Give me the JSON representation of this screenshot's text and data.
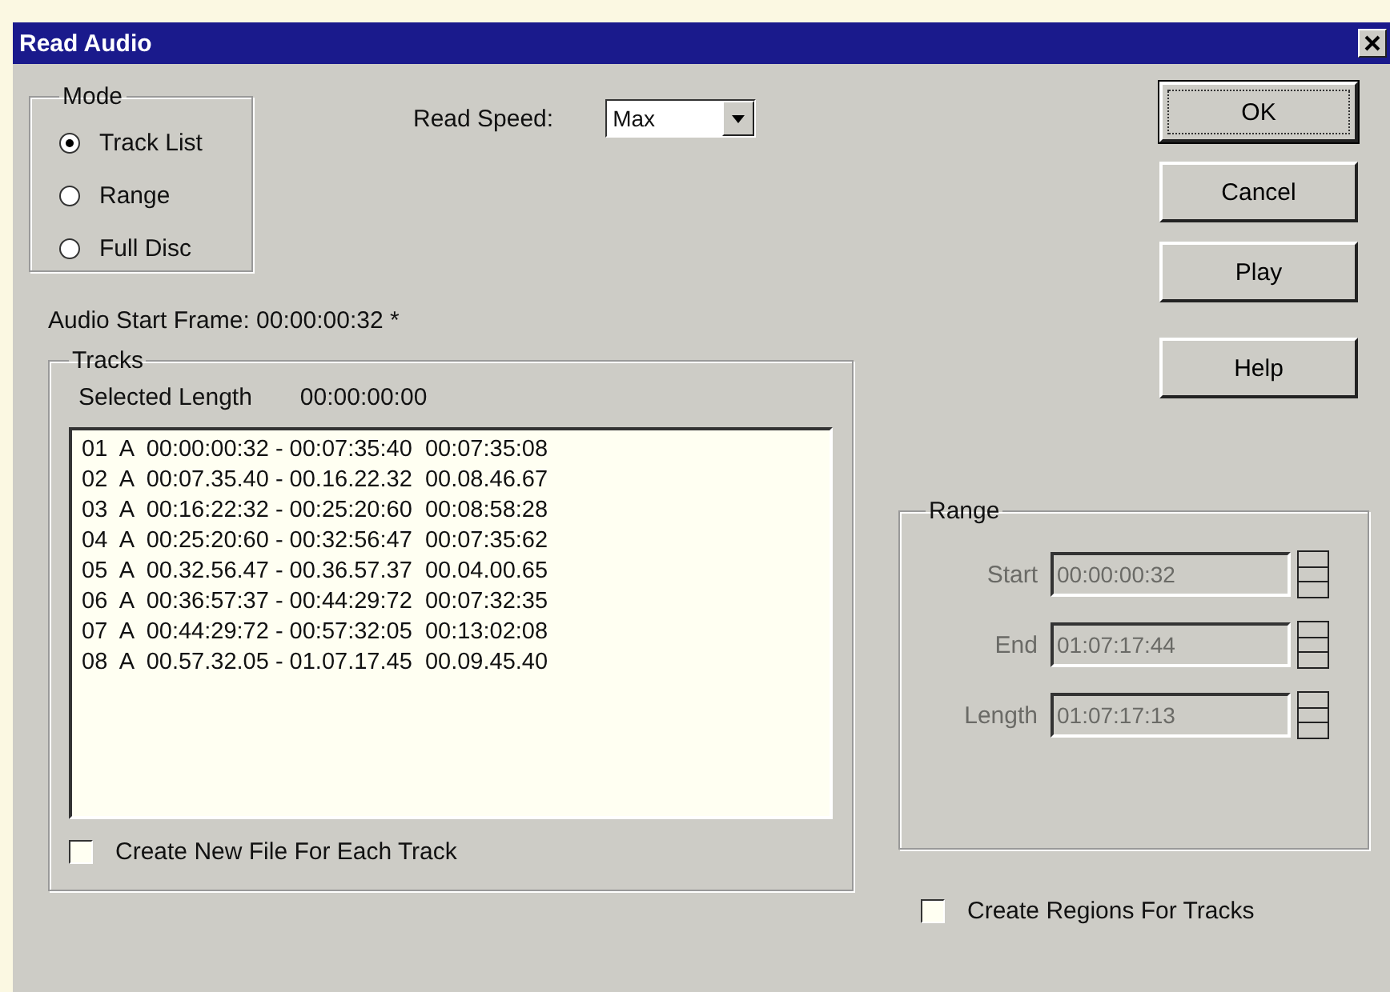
{
  "window": {
    "title": "Read Audio"
  },
  "mode": {
    "label": "Mode",
    "options": [
      {
        "label": "Track List",
        "selected": true
      },
      {
        "label": "Range",
        "selected": false
      },
      {
        "label": "Full Disc",
        "selected": false
      }
    ]
  },
  "read_speed": {
    "label": "Read Speed:",
    "value": "Max"
  },
  "buttons": [
    {
      "label": "OK",
      "focused": true
    },
    {
      "label": "Cancel",
      "focused": false
    },
    {
      "label": "Play",
      "focused": false
    },
    {
      "label": "Help",
      "focused": false
    }
  ],
  "audio_start_frame": "Audio Start Frame: 00:00:00:32 *",
  "tracks": {
    "label": "Tracks",
    "selected_length_label": "Selected Length",
    "selected_length": "00:00:00:00",
    "rows": [
      "01  A  00:00:00:32 - 00:07:35:40  00:07:35:08",
      "02  A  00:07.35.40 - 00.16.22.32  00.08.46.67",
      "03  A  00:16:22:32 - 00:25:20:60  00:08:58:28",
      "04  A  00:25:20:60 - 00:32:56:47  00:07:35:62",
      "05  A  00.32.56.47 - 00.36.57.37  00.04.00.65",
      "06  A  00:36:57:37 - 00:44:29:72  00:07:32:35",
      "07  A  00:44:29:72 - 00:57:32:05  00:13:02:08",
      "08  A  00.57.32.05 - 01.07.17.45  00.09.45.40"
    ],
    "checkbox": {
      "label": "Create New File For Each Track",
      "checked": false
    }
  },
  "range": {
    "label": "Range",
    "fields": [
      {
        "label": "Start",
        "value": "00:00:00:32",
        "disabled": true
      },
      {
        "label": "End",
        "value": "01:07:17:44",
        "disabled": true
      },
      {
        "label": "Length",
        "value": "01:07:17:13",
        "disabled": true
      }
    ]
  },
  "create_regions": {
    "label": "Create Regions For Tracks",
    "checked": false
  }
}
